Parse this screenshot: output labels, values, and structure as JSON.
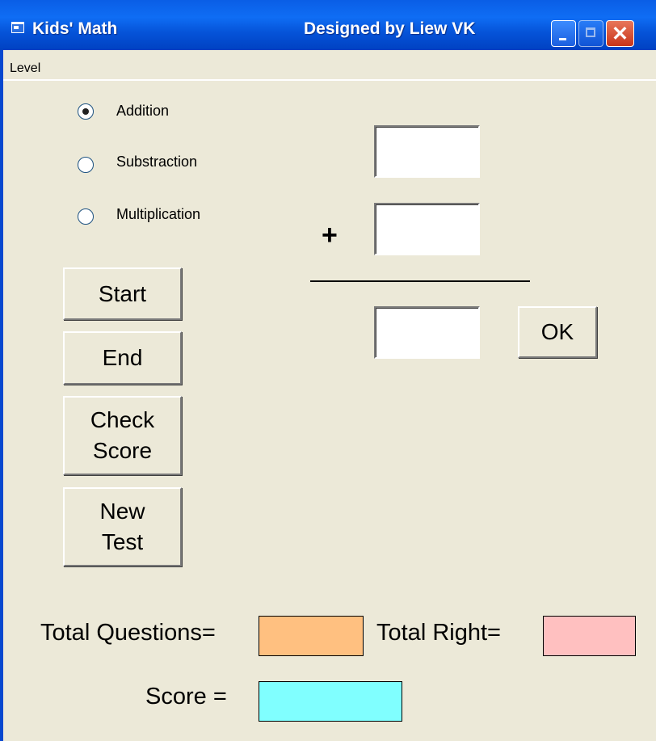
{
  "window": {
    "title": "Kids' Math",
    "designer": "Designed by Liew VK",
    "controls": {
      "minimize_icon": "minimize-icon",
      "maximize_icon": "maximize-icon",
      "close_glyph": "✕"
    }
  },
  "menu": {
    "level": "Level"
  },
  "operations": [
    {
      "label": "Addition",
      "selected": true
    },
    {
      "label": "Substraction",
      "selected": false
    },
    {
      "label": "Multiplication",
      "selected": false
    }
  ],
  "buttons": {
    "start": "Start",
    "end": "End",
    "check_score": [
      "Check",
      "Score"
    ],
    "new_test": [
      "New",
      "Test"
    ],
    "ok": "OK"
  },
  "problem": {
    "first_number": "",
    "operator": "+",
    "second_number": "",
    "answer": ""
  },
  "stats": {
    "total_questions_label": "Total Questions=",
    "total_questions_value": "",
    "total_right_label": "Total Right=",
    "total_right_value": "",
    "score_label": "Score =",
    "score_value": ""
  },
  "colors": {
    "total_questions_box": "#ffc080",
    "total_right_box": "#ffc0c0",
    "score_box": "#80ffff"
  }
}
